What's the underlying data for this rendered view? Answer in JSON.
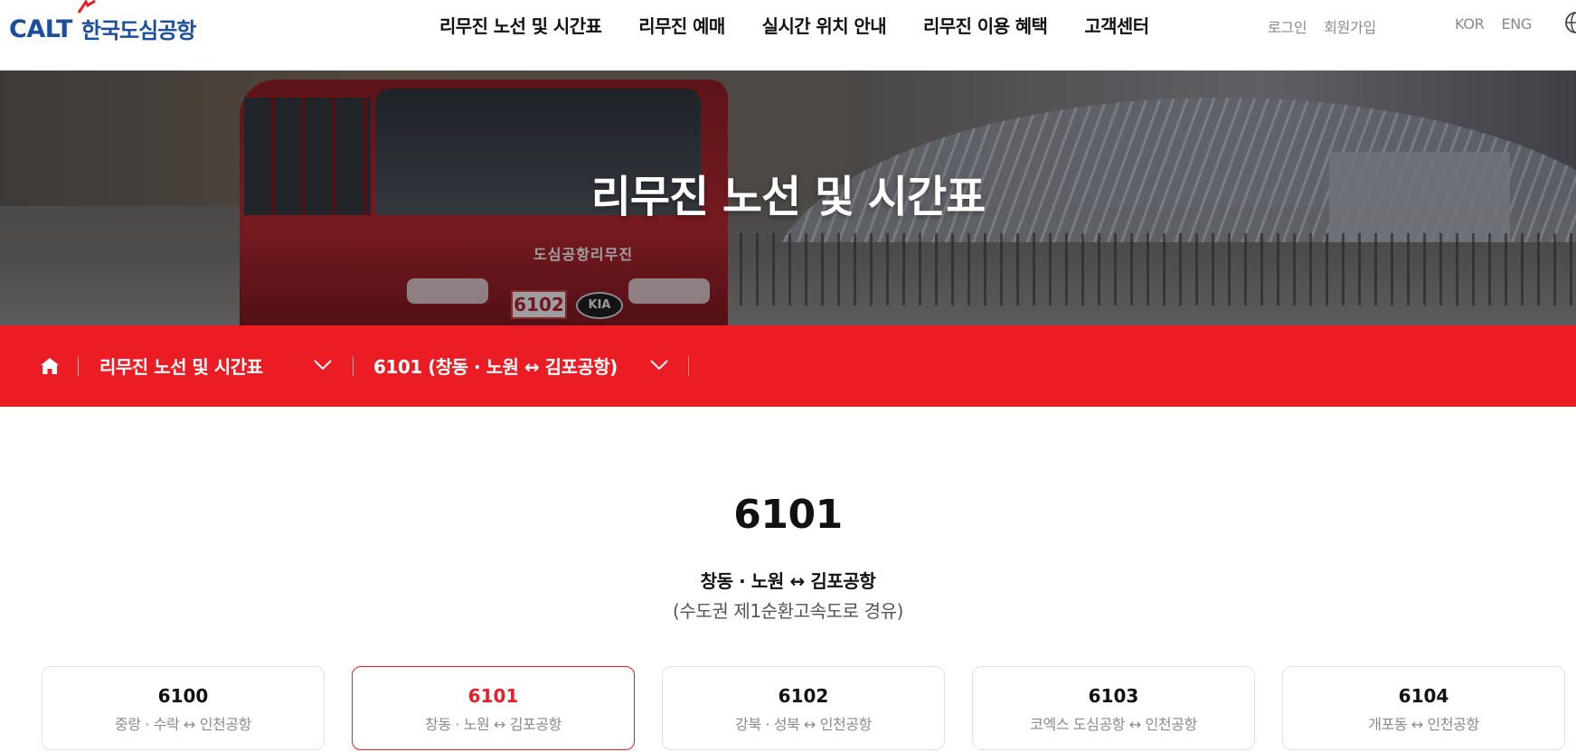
{
  "header": {
    "logo_latin": "CALT",
    "logo_korean": "한국도심공항",
    "nav": [
      "리무진 노선 및 시간표",
      "리무진 예매",
      "실시간 위치 안내",
      "리무진 이용 혜택",
      "고객센터"
    ],
    "auth": {
      "login": "로그인",
      "signup": "회원가입"
    },
    "lang": {
      "kor": "KOR",
      "eng": "ENG"
    },
    "icons": {
      "globe": "globe-icon"
    }
  },
  "hero": {
    "title": "리무진 노선 및 시간표",
    "bus_brand": "도심공항리무진",
    "bus_plate": "6102",
    "bus_badge": "KIA"
  },
  "breadcrumb": {
    "home_icon": "home-icon",
    "level1": "리무진 노선 및 시간표",
    "level2": "6101 (창동 · 노원 ↔ 김포공항)",
    "bar_color": "#ec1c24"
  },
  "route": {
    "number": "6101",
    "name": "창동 · 노원 ↔ 김포공항",
    "via": "(수도권 제1순환고속도로 경유)"
  },
  "route_cards": [
    {
      "number": "6100",
      "desc": "중랑 · 수락 ↔ 인천공항",
      "selected": false
    },
    {
      "number": "6101",
      "desc": "창동 · 노원 ↔ 김포공항",
      "selected": true
    },
    {
      "number": "6102",
      "desc": "강북 · 성북 ↔ 인천공항",
      "selected": false
    },
    {
      "number": "6103",
      "desc": "코엑스 도심공항 ↔ 인천공항",
      "selected": false
    },
    {
      "number": "6104",
      "desc": "개포동 ↔ 인천공항",
      "selected": false
    }
  ],
  "colors": {
    "accent": "#ec1c24",
    "brand_blue": "#1b4f9c"
  }
}
